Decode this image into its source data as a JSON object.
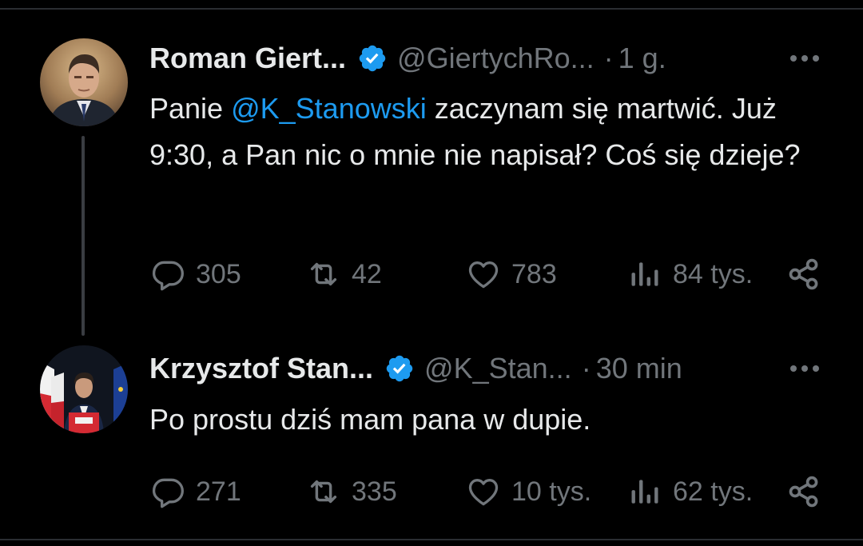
{
  "theme": {
    "background": "#000000",
    "text": "#e7e9ea",
    "secondary": "#71767b",
    "accent": "#1d9bf0"
  },
  "tweets": [
    {
      "author_name": "Roman Giert...",
      "verified": true,
      "handle": "@GiertychRo...",
      "separator": "·",
      "time": "1 g.",
      "text_before": "Panie ",
      "mention": "@K_Stanowski",
      "text_after": " zaczynam się martwić. Już 9:30, a Pan nic o mnie nie napisał? Coś się dzieje?",
      "replies": "305",
      "reposts": "42",
      "likes": "783",
      "views": "84 tys.",
      "icons": [
        "reply-icon",
        "repost-icon",
        "like-icon",
        "views-icon",
        "share-icon",
        "more-icon"
      ]
    },
    {
      "author_name": "Krzysztof Stan...",
      "verified": true,
      "handle": "@K_Stan...",
      "separator": "·",
      "time": "30 min",
      "text": "Po prostu dziś mam pana w dupie.",
      "replies": "271",
      "reposts": "335",
      "likes": "10 tys.",
      "views": "62 tys.",
      "icons": [
        "reply-icon",
        "repost-icon",
        "like-icon",
        "views-icon",
        "share-icon",
        "more-icon"
      ]
    }
  ]
}
